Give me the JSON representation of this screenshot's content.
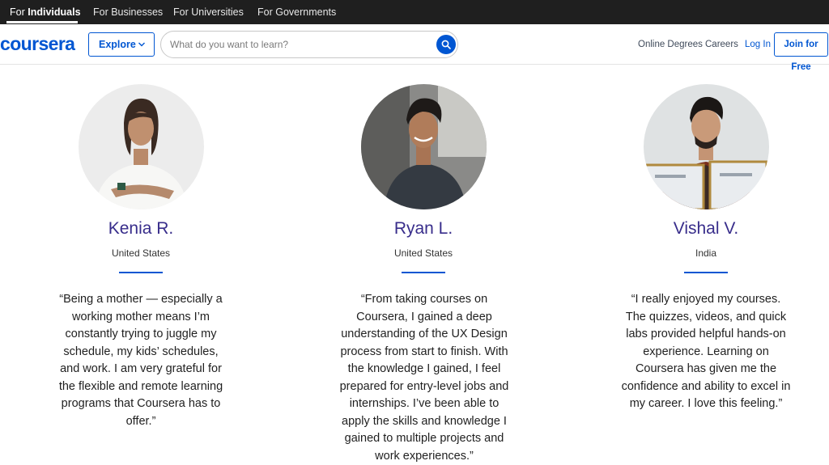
{
  "topbar": {
    "items": [
      {
        "prefix": "For ",
        "label": "Individuals"
      },
      {
        "label": "For Businesses"
      },
      {
        "label": "For Universities"
      },
      {
        "label": "For Governments"
      }
    ]
  },
  "header": {
    "logo": "coursera",
    "explore_label": "Explore",
    "search_placeholder": "What do you want to learn?",
    "links": {
      "online_degrees": "Online Degrees",
      "careers": "Careers",
      "login": "Log In",
      "join": "Join for Free"
    }
  },
  "colors": {
    "brand": "#0056d2",
    "name": "#382d8b",
    "topbar": "#1f1f1f"
  },
  "testimonials": [
    {
      "name": "Kenia R.",
      "location": "United States",
      "quote": "“Being a mother — especially a working mother means I’m constantly trying to juggle my schedule, my kids’ schedules, and work. I am very grateful for the flexible and remote learning programs that Coursera has to offer.”"
    },
    {
      "name": "Ryan L.",
      "location": "United States",
      "quote": "“From taking courses on Coursera, I gained a deep understanding of the UX Design process from start to finish. With the knowledge I gained, I feel prepared for entry-level jobs and internships. I’ve been able to apply the skills and knowledge I gained to multiple projects and work experiences.”"
    },
    {
      "name": "Vishal V.",
      "location": "India",
      "quote": "“I really enjoyed my courses. The quizzes, videos, and quick labs provided helpful hands-on experience. Learning on Coursera has given me the confidence and ability to excel in my career. I love this feeling.”"
    }
  ]
}
